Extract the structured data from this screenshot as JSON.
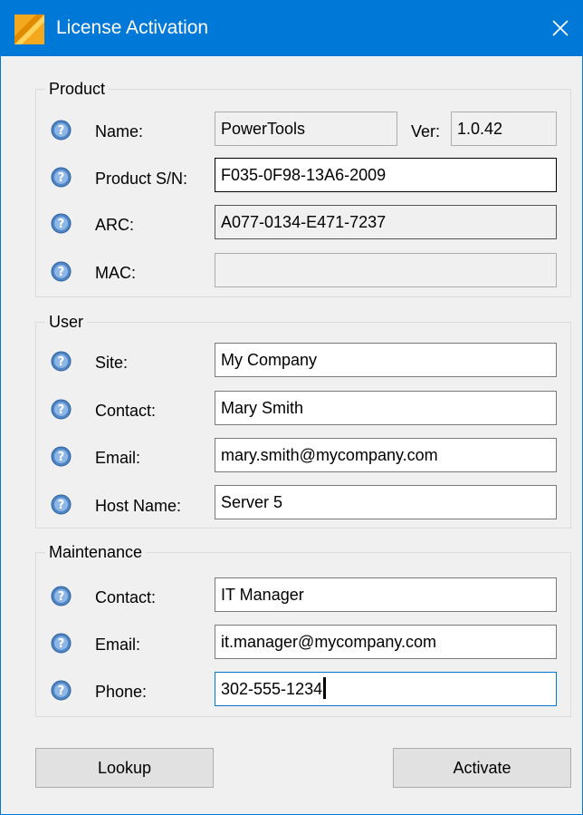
{
  "window": {
    "title": "License Activation"
  },
  "product": {
    "group_label": "Product",
    "name_label": "Name:",
    "name_value": "PowerTools",
    "ver_label": "Ver:",
    "ver_value": "1.0.42",
    "sn_label": "Product S/N:",
    "sn_value": "F035-0F98-13A6-2009",
    "arc_label": "ARC:",
    "arc_value": "A077-0134-E471-7237",
    "mac_label": "MAC:",
    "mac_value": ""
  },
  "user": {
    "group_label": "User",
    "site_label": "Site:",
    "site_value": "My Company",
    "contact_label": "Contact:",
    "contact_value": "Mary Smith",
    "email_label": "Email:",
    "email_value": "mary.smith@mycompany.com",
    "host_label": "Host Name:",
    "host_value": "Server 5"
  },
  "maintenance": {
    "group_label": "Maintenance",
    "contact_label": "Contact:",
    "contact_value": "IT Manager",
    "email_label": "Email:",
    "email_value": "it.manager@mycompany.com",
    "phone_label": "Phone:",
    "phone_value": "302-555-1234"
  },
  "buttons": {
    "lookup": "Lookup",
    "activate": "Activate"
  },
  "icons": {
    "app": "license-app-icon",
    "help": "help-icon",
    "close": "close-icon"
  },
  "colors": {
    "titlebar": "#0078d7",
    "dialog_bg": "#f0f0f0",
    "focus_border": "#0078d7"
  }
}
